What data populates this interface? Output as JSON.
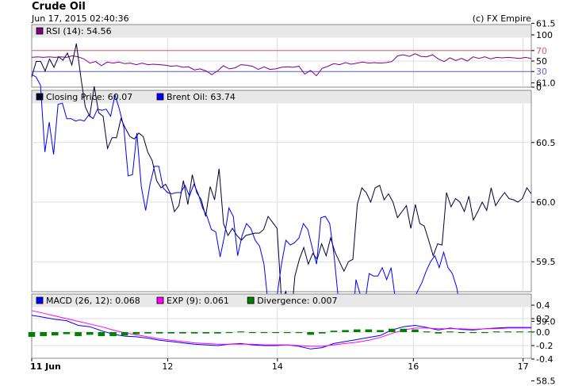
{
  "header": {
    "title": "Crude Oil",
    "timestamp": "Jun 17, 2015 02:40:36",
    "copyright": "(c) FX Empire"
  },
  "chart_data": [
    {
      "type": "line",
      "panel": "rsi",
      "legend": [
        {
          "label": "RSI (14): 54.56",
          "color": "#800080"
        }
      ],
      "y_ticks": [
        "100",
        "70",
        "50",
        "30",
        "0"
      ],
      "ylim": [
        0,
        100
      ],
      "reference_lines": [
        {
          "value": 70,
          "color": "#e06060"
        },
        {
          "value": 30,
          "color": "#6060e0"
        }
      ],
      "series": [
        {
          "name": "RSI (14)",
          "color": "#800080",
          "values": [
            57,
            58,
            57,
            58,
            57,
            58,
            57,
            60,
            58,
            54,
            46,
            49,
            41,
            48,
            46,
            48,
            45,
            46,
            43,
            46,
            43,
            44,
            43,
            42,
            40,
            41,
            38,
            39,
            33,
            35,
            31,
            24,
            31,
            41,
            35,
            37,
            43,
            42,
            40,
            34,
            39,
            34,
            35,
            38,
            39,
            38,
            40,
            25,
            32,
            22,
            36,
            40,
            45,
            43,
            47,
            44,
            46,
            48,
            46,
            47,
            46,
            47,
            49,
            60,
            62,
            59,
            64,
            59,
            58,
            62,
            54,
            49,
            56,
            51,
            55,
            50,
            58,
            55,
            58,
            54,
            57,
            56,
            57,
            56,
            55,
            57,
            55
          ]
        }
      ]
    },
    {
      "type": "line",
      "panel": "price",
      "legend": [
        {
          "label": "Closing Price: 60.07",
          "color": "#000033"
        },
        {
          "label": "Brent Oil: 63.74",
          "color": "#0000ff"
        }
      ],
      "y_ticks": [
        "61.5",
        "61.0",
        "60.5",
        "60.0",
        "59.5",
        "59.0",
        "58.5"
      ],
      "ylim": [
        58.5,
        61.75
      ],
      "series": [
        {
          "name": "Closing Price",
          "color": "#000033",
          "values": [
            61.05,
            61.18,
            61.18,
            61.1,
            61.2,
            61.13,
            61.22,
            61.19,
            61.25,
            61.15,
            61.33,
            61.05,
            60.8,
            60.72,
            60.97,
            60.75,
            60.72,
            60.45,
            60.54,
            60.54,
            60.7,
            60.62,
            60.55,
            60.53,
            60.58,
            60.55,
            60.42,
            60.35,
            60.18,
            60.12,
            60.15,
            60.08,
            59.92,
            59.97,
            60.18,
            59.98,
            60.23,
            60.08,
            60.02,
            59.88,
            60.13,
            60.02,
            60.28,
            59.82,
            59.72,
            59.78,
            59.72,
            59.68,
            59.72,
            59.73,
            59.74,
            59.74,
            59.77,
            59.88,
            59.83,
            59.78,
            59.18,
            59.25,
            58.96,
            59.38,
            59.52,
            59.62,
            59.48,
            59.57,
            59.52,
            59.65,
            59.55,
            59.7,
            59.58,
            59.5,
            59.42,
            59.5,
            59.52,
            59.98,
            60.12,
            60.08,
            60.0,
            60.12,
            60.14,
            60.02,
            60.07,
            60.0,
            59.87,
            59.92,
            59.97,
            59.78,
            59.98,
            59.82,
            59.8,
            59.68,
            59.55,
            59.65,
            59.64,
            60.08,
            59.96,
            60.03,
            60.0,
            59.92,
            60.05,
            59.85,
            59.92,
            60.0,
            59.93,
            60.12,
            59.97,
            60.03,
            60.08,
            60.03,
            60.02,
            60.0,
            60.03,
            60.12,
            60.07
          ]
        },
        {
          "name": "Brent Oil",
          "color": "#0000ff",
          "values": [
            61.07,
            61.05,
            60.98,
            60.42,
            60.67,
            60.4,
            60.82,
            60.83,
            60.7,
            60.7,
            60.68,
            60.69,
            60.68,
            60.73,
            60.7,
            60.78,
            60.77,
            60.78,
            60.72,
            60.9,
            60.78,
            60.63,
            60.22,
            60.23,
            60.58,
            60.13,
            59.93,
            60.15,
            60.3,
            60.3,
            60.12,
            60.08,
            60.07,
            60.08,
            60.08,
            60.14,
            60.05,
            60.15,
            60.07,
            59.95,
            59.88,
            59.77,
            59.75,
            59.54,
            59.72,
            59.95,
            59.88,
            59.55,
            59.72,
            59.82,
            59.78,
            59.68,
            59.63,
            59.48,
            59.13,
            59.02,
            59.22,
            59.48,
            59.68,
            59.64,
            59.66,
            59.7,
            59.82,
            59.77,
            59.62,
            59.48,
            59.87,
            59.88,
            59.82,
            59.55,
            59.18,
            59.05,
            58.98,
            58.88,
            59.35,
            59.22,
            59.15,
            59.4,
            59.38,
            59.38,
            59.45,
            59.35,
            59.45,
            59.18,
            59.22,
            59.18,
            59.08,
            59.15,
            59.25,
            59.32,
            59.42,
            59.5,
            59.55,
            59.45,
            59.58,
            59.45,
            59.4,
            59.28,
            59.05,
            59.15,
            59.2,
            59.2,
            59.08,
            58.97,
            59.0,
            59.05,
            59.12,
            59.08,
            58.97,
            59.1,
            59.03,
            59.03,
            59.05,
            59.1,
            59.07
          ]
        }
      ]
    },
    {
      "type": "line",
      "panel": "macd",
      "legend": [
        {
          "label": "MACD (26, 12): 0.068",
          "color": "#0000ff"
        },
        {
          "label": "EXP (9): 0.061",
          "color": "#ff00ff"
        },
        {
          "label": "Divergence: 0.007",
          "color": "#008000"
        }
      ],
      "y_ticks": [
        "0.4",
        "0.2",
        "0.0",
        "-0.2",
        "-0.4"
      ],
      "ylim": [
        -0.45,
        0.45
      ],
      "series": [
        {
          "name": "MACD (26, 12)",
          "color": "#0000ff",
          "values": [
            0.25,
            0.22,
            0.19,
            0.17,
            0.1,
            0.08,
            0.02,
            -0.03,
            -0.06,
            -0.07,
            -0.09,
            -0.12,
            -0.14,
            -0.16,
            -0.18,
            -0.19,
            -0.2,
            -0.18,
            -0.17,
            -0.19,
            -0.2,
            -0.2,
            -0.19,
            -0.21,
            -0.25,
            -0.23,
            -0.17,
            -0.14,
            -0.11,
            -0.08,
            -0.05,
            0.03,
            0.08,
            0.1,
            0.07,
            0.03,
            0.06,
            0.04,
            0.03,
            0.05,
            0.06,
            0.07,
            0.07,
            0.07
          ]
        },
        {
          "name": "EXP (9)",
          "color": "#ff00ff",
          "values": [
            0.32,
            0.28,
            0.24,
            0.2,
            0.16,
            0.12,
            0.08,
            0.03,
            -0.01,
            -0.04,
            -0.07,
            -0.1,
            -0.12,
            -0.14,
            -0.16,
            -0.17,
            -0.18,
            -0.18,
            -0.18,
            -0.18,
            -0.19,
            -0.19,
            -0.19,
            -0.2,
            -0.21,
            -0.21,
            -0.19,
            -0.17,
            -0.15,
            -0.12,
            -0.08,
            -0.02,
            0.03,
            0.06,
            0.06,
            0.05,
            0.05,
            0.05,
            0.04,
            0.05,
            0.05,
            0.06,
            0.06,
            0.06
          ]
        },
        {
          "name": "Divergence",
          "color": "#008000",
          "values": [
            -0.07,
            -0.06,
            -0.05,
            -0.03,
            -0.06,
            -0.04,
            -0.06,
            -0.06,
            -0.05,
            -0.03,
            -0.02,
            -0.02,
            -0.02,
            -0.02,
            -0.02,
            -0.02,
            -0.02,
            0.0,
            0.01,
            -0.01,
            -0.01,
            -0.01,
            0.0,
            -0.01,
            -0.04,
            -0.02,
            0.02,
            0.03,
            0.04,
            0.04,
            0.03,
            0.05,
            0.05,
            0.04,
            0.01,
            -0.02,
            0.01,
            -0.01,
            -0.01,
            0.0,
            0.01,
            0.01,
            0.01,
            0.01
          ]
        }
      ]
    }
  ],
  "x_axis": {
    "ticks": [
      {
        "label": "11 Jun",
        "pos": 0,
        "bold": true
      },
      {
        "label": "12",
        "pos": 0.2721
      },
      {
        "label": "14",
        "pos": 0.4918
      },
      {
        "label": "16",
        "pos": 0.7639
      },
      {
        "label": "17",
        "pos": 0.9836
      }
    ]
  }
}
